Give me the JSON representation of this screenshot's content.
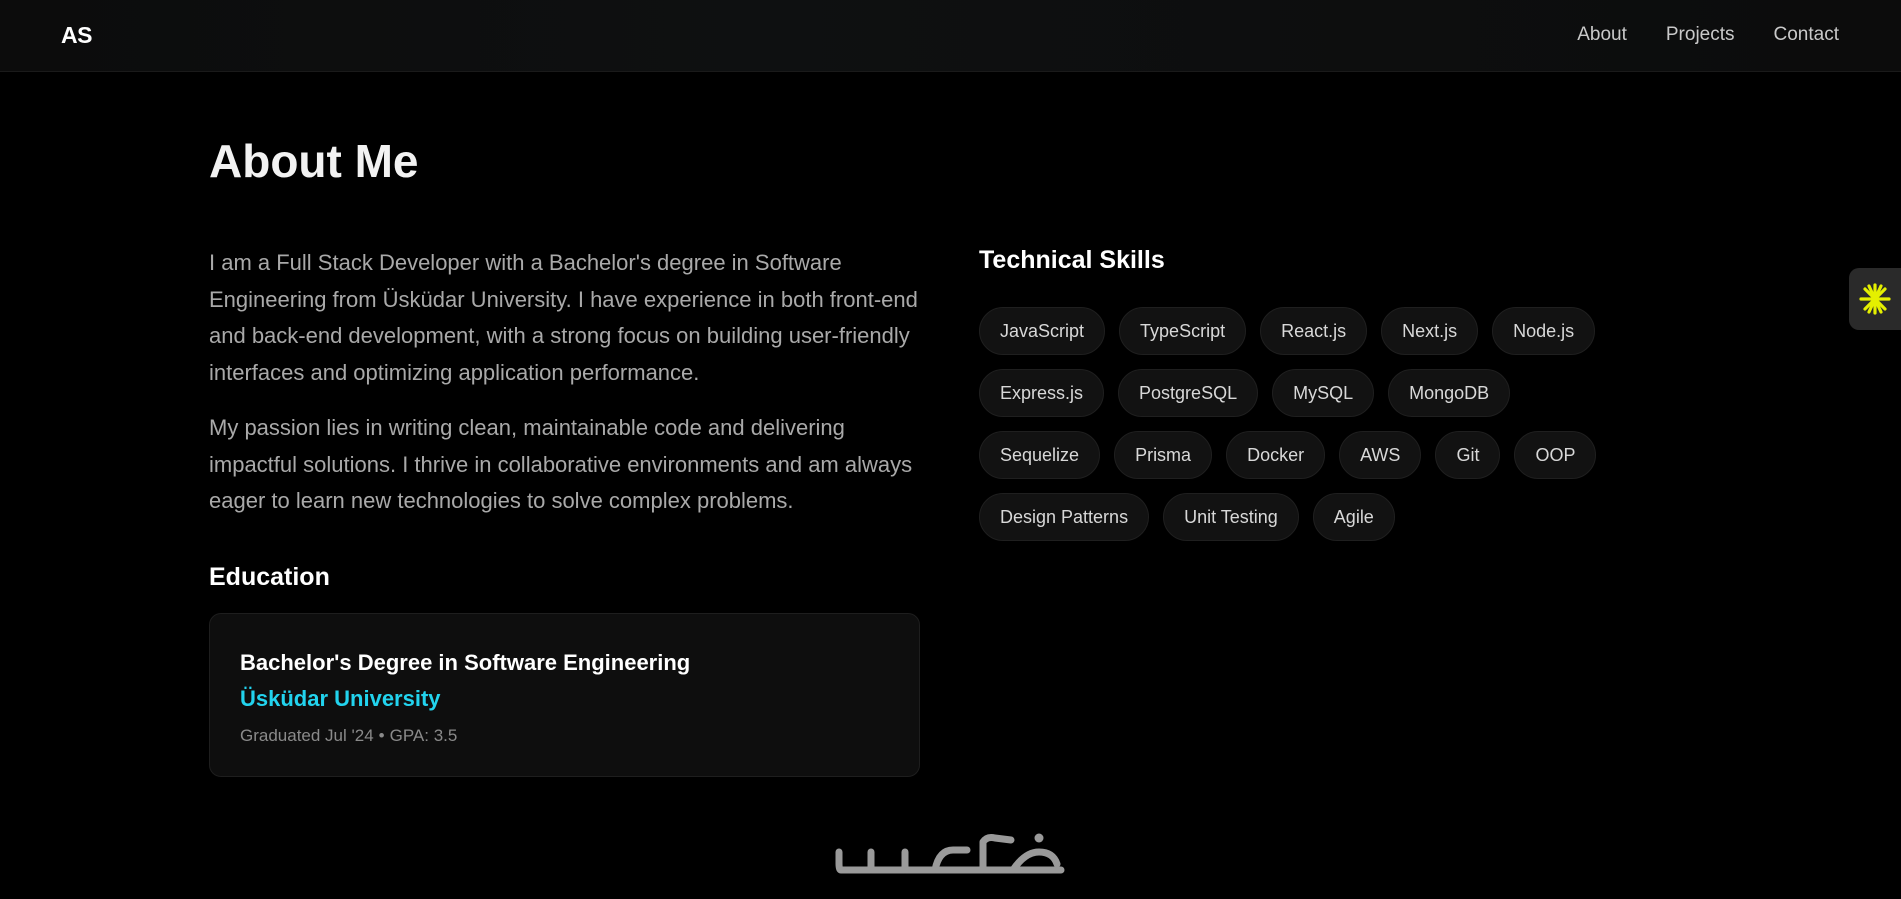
{
  "nav": {
    "logo": "AS",
    "links": [
      "About",
      "Projects",
      "Contact"
    ]
  },
  "page_title": "About Me",
  "about": {
    "paragraphs": [
      "I am a Full Stack Developer with a Bachelor's degree in Software Engineering from Üsküdar University. I have experience in both front-end and back-end development, with a strong focus on building user-friendly interfaces and optimizing application performance.",
      "My passion lies in writing clean, maintainable code and delivering impactful solutions. I thrive in collaborative environments and am always eager to learn new technologies to solve complex problems."
    ]
  },
  "education": {
    "heading": "Education",
    "degree": "Bachelor's Degree in Software Engineering",
    "school": "Üsküdar University",
    "graduated": "Graduated Jul '24",
    "separator": "•",
    "gpa": "GPA: 3.5"
  },
  "skills": {
    "heading": "Technical Skills",
    "items": [
      "JavaScript",
      "TypeScript",
      "React.js",
      "Next.js",
      "Node.js",
      "Express.js",
      "PostgreSQL",
      "MySQL",
      "MongoDB",
      "Sequelize",
      "Prisma",
      "Docker",
      "AWS",
      "Git",
      "OOP",
      "Design Patterns",
      "Unit Testing",
      "Agile"
    ]
  },
  "side_tab": {
    "icon": "asterisk-icon",
    "color": "#e5f000"
  },
  "watermark": {
    "icon": "arabic-logo-watermark",
    "text": "خمسات"
  },
  "colors": {
    "background": "#000000",
    "accent": "#22d3ee",
    "muted_text": "#a9a9a9"
  }
}
